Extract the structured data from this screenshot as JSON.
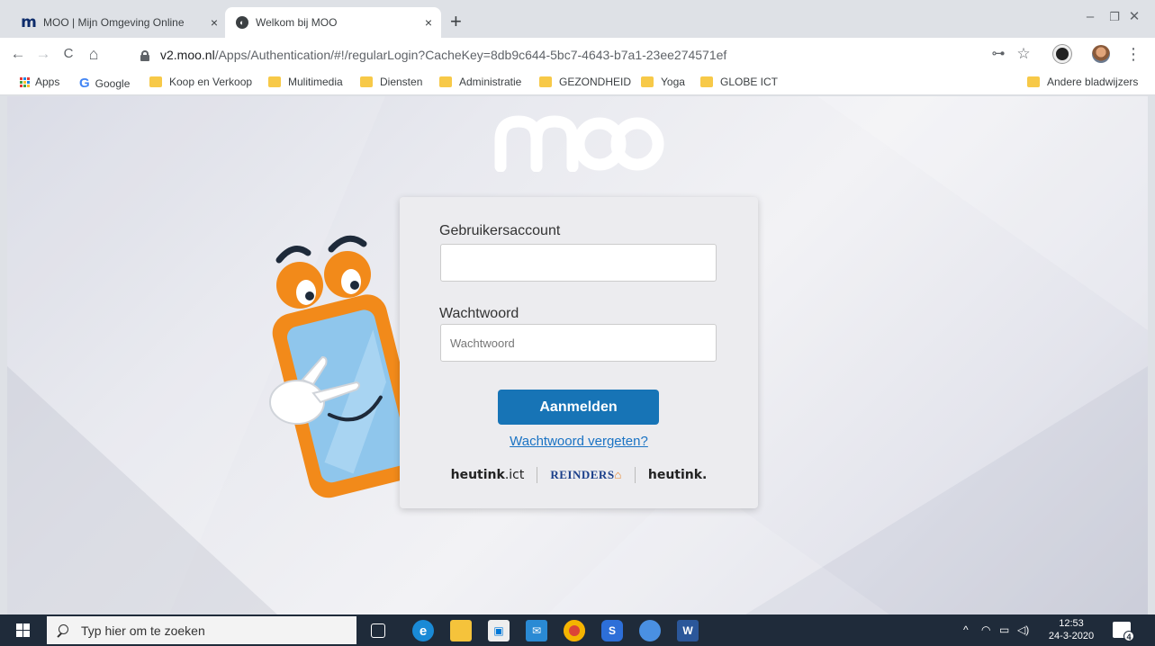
{
  "browser": {
    "tabs": [
      {
        "title": "MOO | Mijn Omgeving Online",
        "close": "×",
        "favicon": "moo-m-icon"
      },
      {
        "title": "Welkom bij MOO",
        "close": "×",
        "favicon": "globe-icon"
      }
    ],
    "new_tab": "+",
    "url_host": "v2.moo.nl",
    "url_path": "/Apps/Authentication/#!/regularLogin?CacheKey=8db9c644-5bc7-4643-b7a1-23ee274571ef",
    "window_controls": {
      "minimize": "–",
      "restore": "❐",
      "close": "✕"
    },
    "nav": {
      "back": "←",
      "forward": "→",
      "reload": "C",
      "home": "⌂"
    },
    "toolbar_icons": {
      "key": "⊶",
      "star": "☆",
      "menu": "⋮"
    }
  },
  "bookmarks": {
    "apps": "Apps",
    "google": "Google",
    "google_letter": "G",
    "items": [
      "Koop en Verkoop",
      "Mulitimedia",
      "Diensten",
      "Administratie",
      "GEZONDHEID",
      "Yoga",
      "GLOBE ICT"
    ],
    "other": "Andere bladwijzers"
  },
  "login": {
    "logo_text": "moo",
    "username_label": "Gebruikersaccount",
    "username_value": "",
    "password_label": "Wachtwoord",
    "password_placeholder": "Wachtwoord",
    "submit_label": "Aanmelden",
    "forgot_link": "Wachtwoord vergeten?",
    "brands": {
      "heutink_ict_bold": "heutink",
      "heutink_ict_suffix": ".ict",
      "reinders": "REINDERS",
      "heutink": "heutink."
    }
  },
  "taskbar": {
    "search_placeholder": "Typ hier om te zoeken",
    "tray_chevron": "^",
    "time": "12:53",
    "date": "24-3-2020",
    "notification_count": "4"
  },
  "colors": {
    "accent_button": "#1774b6",
    "link": "#1a73c4",
    "mascot_orange": "#f28a1a",
    "mascot_screen": "#8fc6ec"
  }
}
